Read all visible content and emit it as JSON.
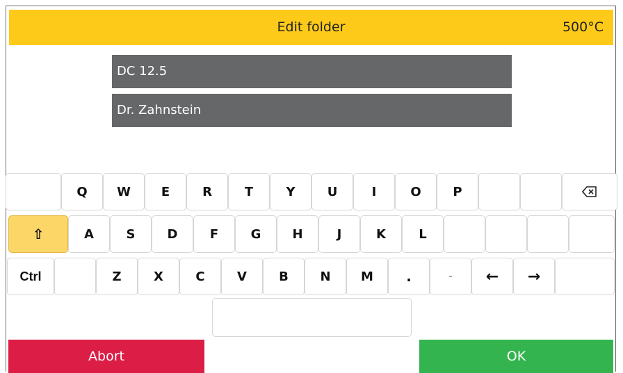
{
  "header": {
    "title": "Edit folder",
    "temperature": "500°C"
  },
  "fields": {
    "name": "DC 12.5",
    "doctor": "Dr. Zahnstein"
  },
  "keyboard": {
    "row1": [
      "Q",
      "W",
      "E",
      "R",
      "T",
      "Y",
      "U",
      "I",
      "O",
      "P"
    ],
    "row2": [
      "A",
      "S",
      "D",
      "F",
      "G",
      "H",
      "J",
      "K",
      "L"
    ],
    "row3": [
      "Z",
      "X",
      "C",
      "V",
      "B",
      "N",
      "M",
      ".",
      "-",
      "←",
      "→"
    ],
    "ctrl": "Ctrl",
    "shift_glyph": "⇧",
    "backspace_icon": "backspace-icon"
  },
  "buttons": {
    "abort": "Abort",
    "ok": "OK"
  },
  "colors": {
    "header": "#fdca1a",
    "field": "#666769",
    "abort": "#dc1e46",
    "ok": "#34b44f",
    "shift_active": "#fdd668"
  }
}
